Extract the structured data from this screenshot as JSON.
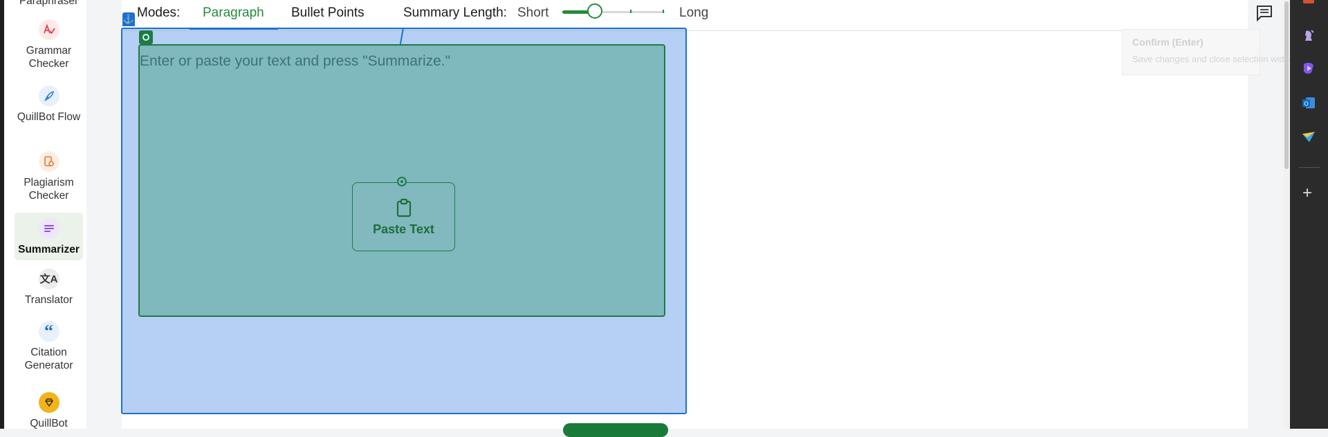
{
  "sidebar": {
    "items": [
      {
        "label": "Paraphraser",
        "icon": "paraphraser-icon",
        "color": "#c23a3a"
      },
      {
        "label": "Grammar Checker",
        "icon": "grammar-checker-icon",
        "color": "#e0434d"
      },
      {
        "label": "QuillBot Flow",
        "icon": "quill-pen-icon",
        "color": "#2f7fd6"
      },
      {
        "label": "Plagiarism Checker",
        "icon": "plagiarism-icon",
        "color": "#e8742a"
      },
      {
        "label": "Summarizer",
        "icon": "summarizer-icon",
        "color": "#8a4fe0",
        "active": true
      },
      {
        "label": "Translator",
        "icon": "translator-icon",
        "color": "#333333"
      },
      {
        "label": "Citation Generator",
        "icon": "quote-icon",
        "color": "#1f6fd0"
      },
      {
        "label": "QuillBot",
        "icon": "premium-diamond-icon",
        "color": "#f2b41b"
      }
    ]
  },
  "toolbar": {
    "modes_label": "Modes:",
    "tabs": [
      {
        "label": "Paragraph",
        "active": true
      },
      {
        "label": "Bullet Points",
        "active": false
      }
    ],
    "summary_length_label": "Summary Length:",
    "short_label": "Short",
    "long_label": "Long",
    "slider_value": 0.25
  },
  "editor": {
    "placeholder": "Enter or paste your text and press \"Summarize.\"",
    "paste_button_label": "Paste Text"
  },
  "tooltip": {
    "title": "Confirm (Enter)",
    "description": "Save changes and close selection widget"
  },
  "colors": {
    "brand_green": "#268a3c",
    "selection_blue": "#1f6fd0",
    "textarea_fill": "#7fb8bd"
  }
}
